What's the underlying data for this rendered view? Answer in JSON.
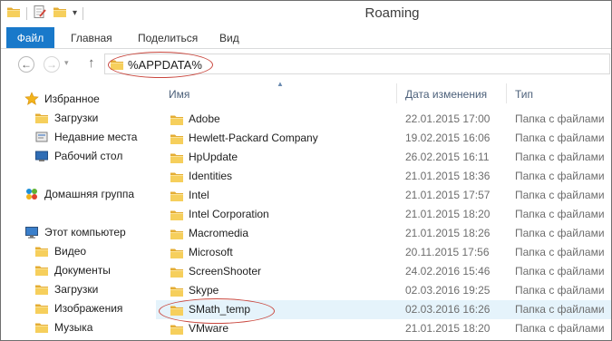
{
  "window": {
    "title": "Roaming"
  },
  "ribbon": {
    "file_tab": "Файл",
    "tabs": [
      "Главная",
      "Поделиться",
      "Вид"
    ]
  },
  "address": {
    "path": "%APPDATA%"
  },
  "nav": {
    "favorites": "Избранное",
    "favorites_items": [
      "Загрузки",
      "Недавние места",
      "Рабочий стол"
    ],
    "homegroup": "Домашняя группа",
    "computer": "Этот компьютер",
    "computer_items": [
      "Видео",
      "Документы",
      "Загрузки",
      "Изображения",
      "Музыка"
    ]
  },
  "columns": {
    "name": "Имя",
    "date": "Дата изменения",
    "type": "Тип"
  },
  "files": [
    {
      "name": "Adobe",
      "date": "22.01.2015 17:00",
      "type": "Папка с файлами"
    },
    {
      "name": "Hewlett-Packard Company",
      "date": "19.02.2015 16:06",
      "type": "Папка с файлами"
    },
    {
      "name": "HpUpdate",
      "date": "26.02.2015 16:11",
      "type": "Папка с файлами"
    },
    {
      "name": "Identities",
      "date": "21.01.2015 18:36",
      "type": "Папка с файлами"
    },
    {
      "name": "Intel",
      "date": "21.01.2015 17:57",
      "type": "Папка с файлами"
    },
    {
      "name": "Intel Corporation",
      "date": "21.01.2015 18:20",
      "type": "Папка с файлами"
    },
    {
      "name": "Macromedia",
      "date": "21.01.2015 18:26",
      "type": "Папка с файлами"
    },
    {
      "name": "Microsoft",
      "date": "20.11.2015 17:56",
      "type": "Папка с файлами"
    },
    {
      "name": "ScreenShooter",
      "date": "24.02.2016 15:46",
      "type": "Папка с файлами"
    },
    {
      "name": "Skype",
      "date": "02.03.2016 19:25",
      "type": "Папка с файлами"
    },
    {
      "name": "SMath_temp",
      "date": "02.03.2016 16:26",
      "type": "Папка с файлами"
    },
    {
      "name": "VMware",
      "date": "21.01.2015 18:20",
      "type": "Папка с файлами"
    }
  ],
  "colors": {
    "file_tab": "#1979ca",
    "folder": "#f0c24c",
    "annotation": "#c9463d",
    "hover_row": "#e5f3fb"
  }
}
